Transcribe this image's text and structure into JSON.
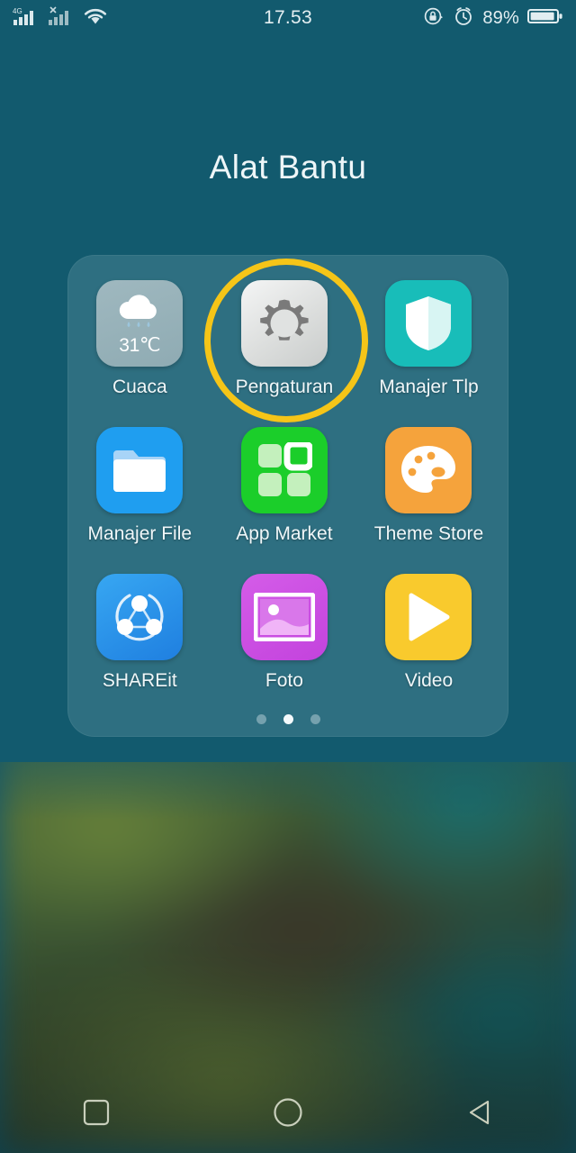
{
  "status_bar": {
    "network_type": "4G",
    "sim1_icon": "signal-bars-icon",
    "sim2_icon": "signal-bars-no-service-icon",
    "wifi_icon": "wifi-icon",
    "time": "17.53",
    "rotation_lock_icon": "rotation-lock-icon",
    "alarm_icon": "alarm-clock-icon",
    "battery_percent": "89%",
    "battery_icon": "battery-icon"
  },
  "folder": {
    "title": "Alat Bantu",
    "apps": [
      {
        "label": "Cuaca",
        "icon": "weather-rain-icon",
        "badge": "31℃",
        "color": "#9fb8bf"
      },
      {
        "label": "Pengaturan",
        "icon": "gear-icon",
        "color": "#e2e4e3",
        "highlighted": true
      },
      {
        "label": "Manajer Tlp",
        "icon": "shield-icon",
        "color": "#18bdb9"
      },
      {
        "label": "Manajer File",
        "icon": "folder-icon",
        "color": "#1f9ef0"
      },
      {
        "label": "App Market",
        "icon": "app-grid-icon",
        "color": "#1bce2a"
      },
      {
        "label": "Theme Store",
        "icon": "palette-icon",
        "color": "#f5a33c"
      },
      {
        "label": "SHAREit",
        "icon": "share-nodes-icon",
        "color": "#2b8ee8"
      },
      {
        "label": "Foto",
        "icon": "photo-icon",
        "color": "#c94ddd"
      },
      {
        "label": "Video",
        "icon": "play-triangle-icon",
        "color": "#f9ca2d"
      }
    ],
    "page_dots": {
      "count": 3,
      "active_index": 1
    }
  },
  "annotation": {
    "highlight_target": "Pengaturan",
    "highlight_color": "#f5c518",
    "shape": "circle"
  },
  "nav_bar": {
    "recents_icon": "square-recents-icon",
    "home_icon": "circle-home-icon",
    "back_icon": "triangle-back-icon"
  },
  "theme": {
    "background_top": "#125a6e",
    "panel_tint": "rgba(190,225,230,0.16)",
    "text_color": "#f0f7f9"
  }
}
